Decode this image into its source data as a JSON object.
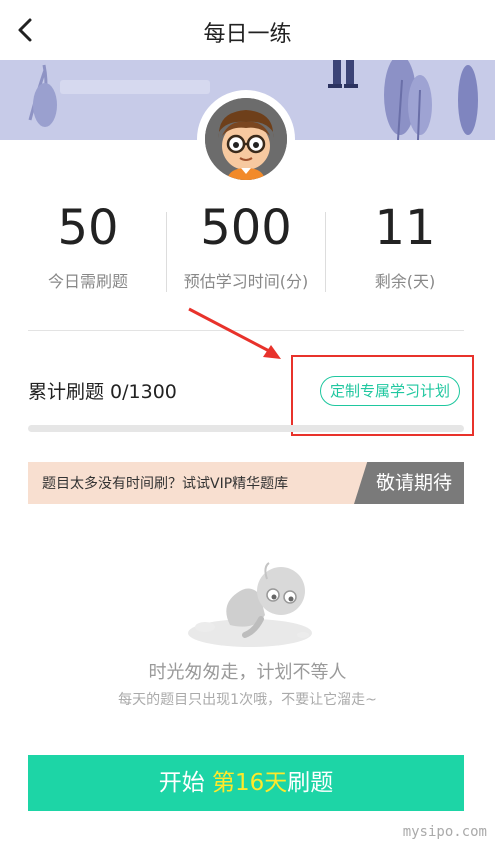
{
  "header": {
    "title": "每日一练",
    "back_icon": "back-chevron-icon"
  },
  "stats": [
    {
      "value": "50",
      "label": "今日需刷题"
    },
    {
      "value": "500",
      "label": "预估学习时间(分)"
    },
    {
      "value": "11",
      "label": "剩余(天)"
    }
  ],
  "progress": {
    "label": "累计刷题 0/1300",
    "done": 0,
    "total": 1300,
    "plan_button": "定制专属学习计划"
  },
  "promo": {
    "text": "题目太多没有时间刷？试试VIP精华题库",
    "button": "敬请期待"
  },
  "empty_state": {
    "title": "时光匆匆走，计划不等人",
    "subtitle": "每天的题目只出现1次哦，不要让它溜走~"
  },
  "start_button": {
    "prefix": "开始 ",
    "highlight": "第16天",
    "suffix": "刷题"
  },
  "watermark": "mysipo.com",
  "colors": {
    "accent": "#1fc79f",
    "start_bg": "#1dd5a6",
    "highlight": "#ffe92a",
    "annotation": "#e8322b"
  }
}
